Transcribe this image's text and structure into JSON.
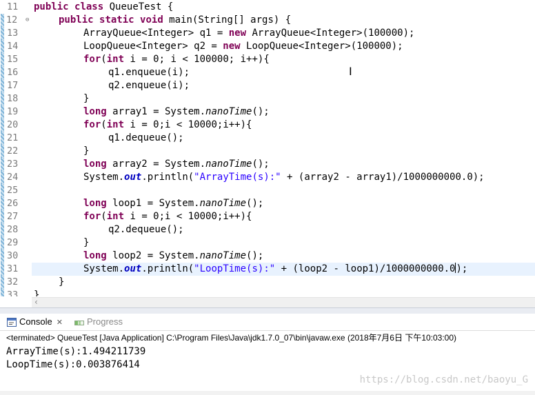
{
  "editor": {
    "line_numbers": [
      "11",
      "12",
      "13",
      "14",
      "15",
      "16",
      "17",
      "18",
      "19",
      "20",
      "21",
      "22",
      "23",
      "24",
      "25",
      "26",
      "27",
      "28",
      "29",
      "30",
      "31",
      "32",
      "33"
    ],
    "l11": {
      "kw1": "public",
      "kw2": "class",
      "rest": " QueueTest {"
    },
    "l12": {
      "kw1": "public",
      "kw2": "static",
      "kw3": "void",
      "rest": " main(String[] args) {"
    },
    "l13": {
      "a": "ArrayQueue<Integer> q1 = ",
      "kw": "new",
      "b": " ArrayQueue<Integer>(100000);"
    },
    "l14": {
      "a": "LoopQueue<Integer> q2 = ",
      "kw": "new",
      "b": " LoopQueue<Integer>(100000);"
    },
    "l15": {
      "kw1": "for",
      "p": "(",
      "kw2": "int",
      "rest": " i = 0; i < 100000; i++){"
    },
    "l16": {
      "text": "q1.enqueue(i);"
    },
    "l17": {
      "text": "q2.enqueue(i);"
    },
    "l18": {
      "text": "}"
    },
    "l19": {
      "kw": "long",
      "a": " array1 = System.",
      "it": "nanoTime",
      "b": "();"
    },
    "l20": {
      "kw1": "for",
      "p": "(",
      "kw2": "int",
      "rest": " i = 0;i < 10000;i++){"
    },
    "l21": {
      "text": "q1.dequeue();"
    },
    "l22": {
      "text": "}"
    },
    "l23": {
      "kw": "long",
      "a": " array2 = System.",
      "it": "nanoTime",
      "b": "();"
    },
    "l24": {
      "a": "System.",
      "fld": "out",
      "b": ".println(",
      "str": "\"ArrayTime(s):\"",
      "c": " + (array2 - array1)/1000000000.0);"
    },
    "l26": {
      "kw": "long",
      "a": " loop1 = System.",
      "it": "nanoTime",
      "b": "();"
    },
    "l27": {
      "kw1": "for",
      "p": "(",
      "kw2": "int",
      "rest": " i = 0;i < 10000;i++){"
    },
    "l28": {
      "text": "q2.dequeue();"
    },
    "l29": {
      "text": "}"
    },
    "l30": {
      "kw": "long",
      "a": " loop2 = System.",
      "it": "nanoTime",
      "b": "();"
    },
    "l31": {
      "a": "System.",
      "fld": "out",
      "b": ".println(",
      "str": "\"LoopTime(s):\"",
      "c": " + (loop2 - loop1)/1000000000.0",
      "d": ");"
    },
    "l32": {
      "text": "}"
    },
    "l33": {
      "text": "}"
    }
  },
  "console": {
    "tab_console": "Console",
    "tab_progress": "Progress",
    "status": "<terminated> QueueTest [Java Application] C:\\Program Files\\Java\\jdk1.7.0_07\\bin\\javaw.exe (2018年7月6日 下午10:03:00)",
    "output": [
      "ArrayTime(s):1.494211739",
      "LoopTime(s):0.003876414"
    ]
  },
  "watermark": "https://blog.csdn.net/baoyu_G",
  "colors": {
    "keyword": "#7f0055",
    "string": "#2a00ff",
    "field": "#0000c0",
    "current_line": "#e8f2fe"
  },
  "icons": [
    "fold-minus-icon",
    "console-icon",
    "progress-icon",
    "close-icon",
    "scroll-left-arrow-icon"
  ]
}
